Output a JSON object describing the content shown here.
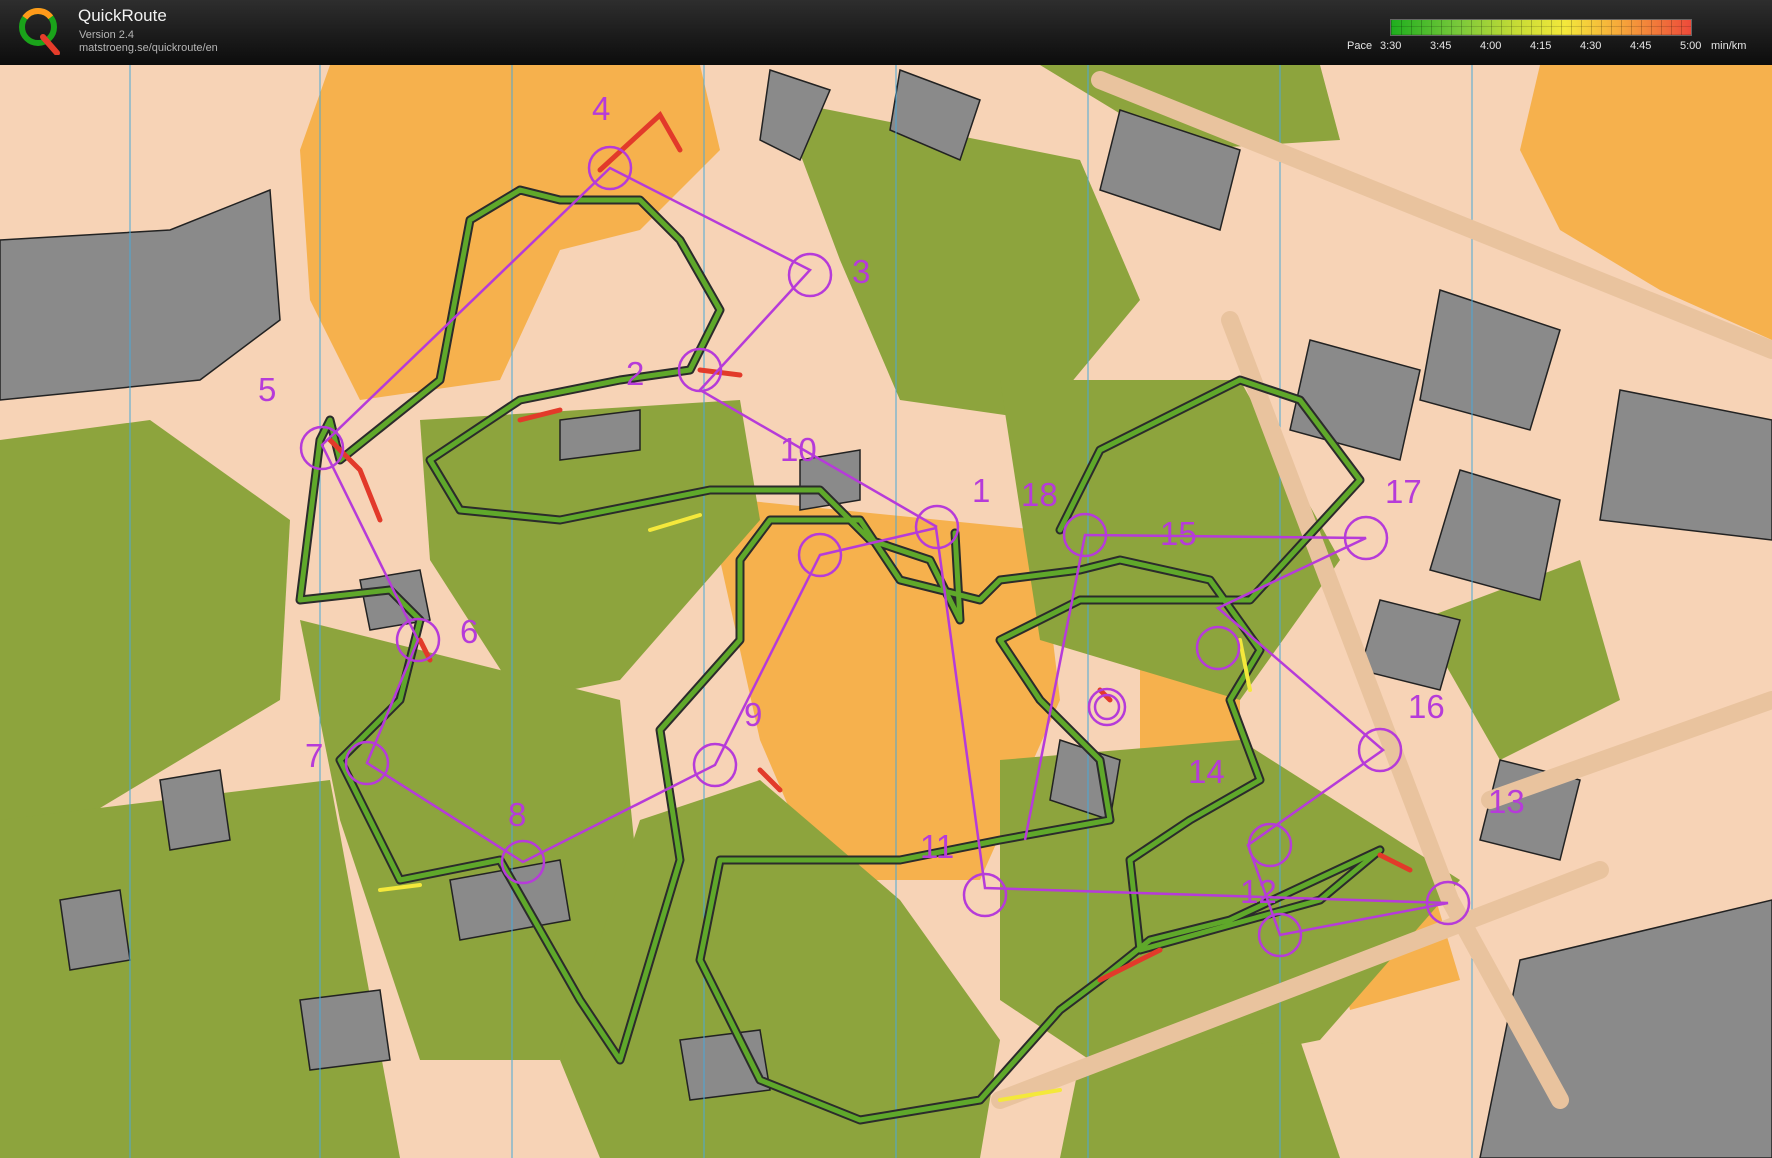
{
  "app": {
    "title": "QuickRoute",
    "version": "Version 2.4",
    "url": "matstroeng.se/quickroute/en",
    "logo_letter": "Q"
  },
  "legend": {
    "label": "Pace",
    "ticks": [
      "3:30",
      "3:45",
      "4:00",
      "4:15",
      "4:30",
      "4:45",
      "5:00"
    ],
    "unit": "min/km",
    "colors": [
      "#1eae1e",
      "#77c83a",
      "#c7dc35",
      "#f4e83b",
      "#f6a93a",
      "#ed4a3a"
    ]
  },
  "map": {
    "colors": {
      "open_land": "#f7d3b6",
      "green_area": "#8da43d",
      "building": "#8a8a8a",
      "rough_open": "#f6b14d",
      "course": "#b63bd9",
      "route_slow": "#e23a2a",
      "route_fast": "#2a8a24",
      "route_edge": "#2b2b2b",
      "meridian": "#4aa8d8"
    },
    "controls": [
      "1",
      "2",
      "3",
      "4",
      "5",
      "6",
      "7",
      "8",
      "9",
      "10",
      "11",
      "12",
      "13",
      "14",
      "15",
      "16",
      "17",
      "18"
    ]
  }
}
